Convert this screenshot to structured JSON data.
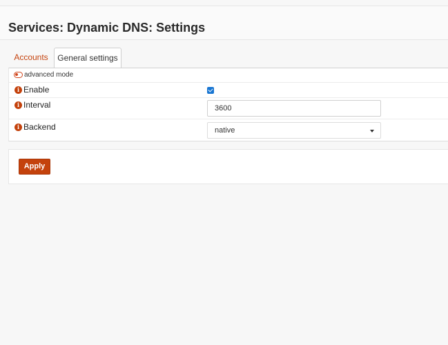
{
  "page": {
    "title": "Services: Dynamic DNS: Settings"
  },
  "tabs": [
    {
      "label": "Accounts",
      "active": false
    },
    {
      "label": "General settings",
      "active": true
    }
  ],
  "form": {
    "advanced_mode": {
      "label": "advanced mode",
      "icon": "toggle-off-icon"
    },
    "enable": {
      "label": "Enable",
      "checked": true
    },
    "interval": {
      "label": "Interval",
      "value": "3600"
    },
    "backend": {
      "label": "Backend",
      "selected": "native"
    },
    "info_icon": "i"
  },
  "actions": {
    "apply_label": "Apply"
  },
  "colors": {
    "accent": "#c4420c",
    "checkbox": "#1976d2"
  }
}
